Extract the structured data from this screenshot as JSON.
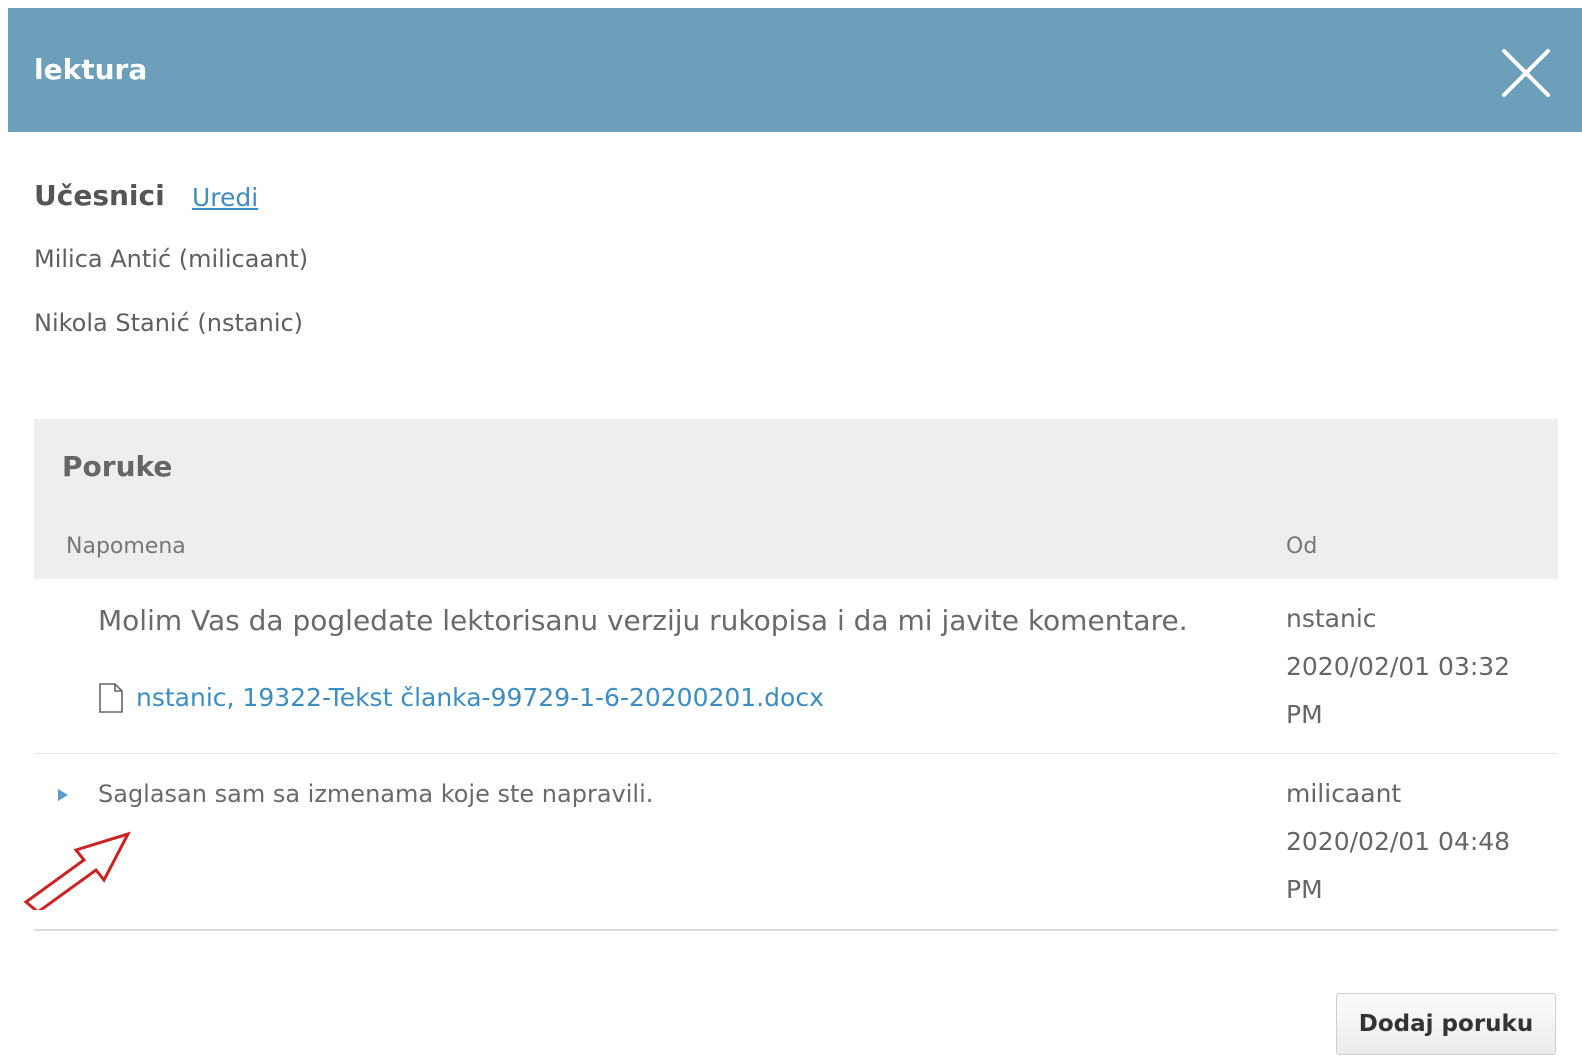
{
  "modal": {
    "title": "lektura",
    "close_icon": "close-icon"
  },
  "participants": {
    "title": "Učesnici",
    "edit_label": "Uredi",
    "list": [
      "Milica Antić (milicaant)",
      "Nikola Stanić (nstanic)"
    ]
  },
  "messages": {
    "title": "Poruke",
    "columns": {
      "note": "Napomena",
      "from": "Od"
    },
    "rows": [
      {
        "text": "Molim Vas da pogledate lektorisanu verziju rukopisa i da mi javite komentare.",
        "attachment": "nstanic, 19322-Tekst članka-99729-1-6-20200201.docx",
        "attachment_icon": "file-icon",
        "sender": "nstanic",
        "date": "2020/02/01 03:32",
        "time_suffix": "PM"
      },
      {
        "text": "Saglasan sam sa izmenama koje ste napravili.",
        "toggle_icon": "triangle-right-icon",
        "sender": "milicaant",
        "date": "2020/02/01 04:48",
        "time_suffix": "PM"
      }
    ]
  },
  "annotation": {
    "icon": "red-arrow-icon",
    "color": "#cc2222"
  },
  "footer": {
    "add_message_label": "Dodaj poruku"
  },
  "colors": {
    "header": "#6b9fba",
    "link": "#3b8ec4",
    "panel": "#eeeeee"
  }
}
